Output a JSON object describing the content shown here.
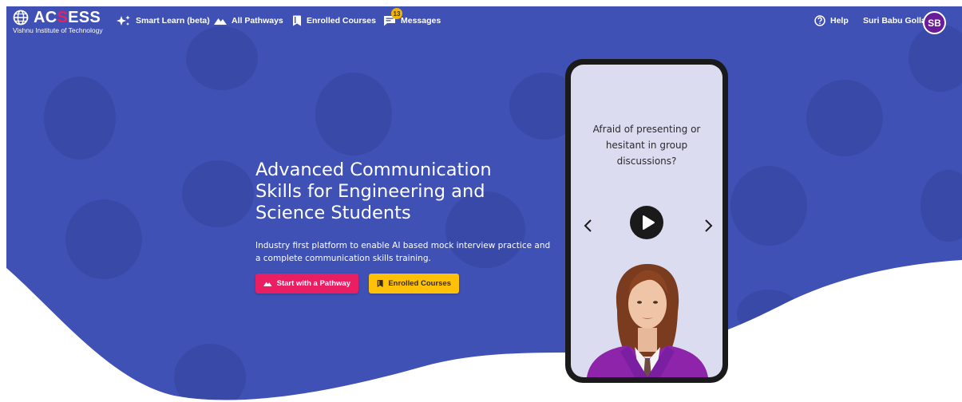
{
  "brand": {
    "name_part1": "AC",
    "name_accent": "S",
    "name_part2": "ESS",
    "subtitle": "Vishnu Institute of Technology"
  },
  "nav": {
    "smart_learn": "Smart Learn (beta)",
    "all_pathways": "All Pathways",
    "enrolled_courses": "Enrolled Courses",
    "messages": "Messages",
    "messages_count": "13",
    "help": "Help",
    "user_name": "Suri Babu Golla",
    "user_initials": "SB"
  },
  "hero": {
    "title": "Advanced Communication Skills for Engineering and Science Students",
    "description": "Industry first platform to enable AI based mock interview practice and a complete communication skills training.",
    "btn_pathway": "Start with a Pathway",
    "btn_enrolled": "Enrolled Courses"
  },
  "phone": {
    "question": "Afraid of presenting or hesitant in group discussions?"
  },
  "colors": {
    "hero_blue": "#3f51b5",
    "blob_blue": "#3949a8",
    "pink": "#e91e63",
    "amber": "#ffc107",
    "avatar_purple": "#6a1b9a"
  },
  "icons": {
    "brand": "globe-icon",
    "smart_learn": "sparkle-icon",
    "pathways": "mountain-icon",
    "enrolled": "bookmark-icon",
    "messages": "chat-icon",
    "help": "help-circle-icon",
    "play": "play-icon",
    "prev": "chevron-left-icon",
    "next": "chevron-right-icon"
  }
}
